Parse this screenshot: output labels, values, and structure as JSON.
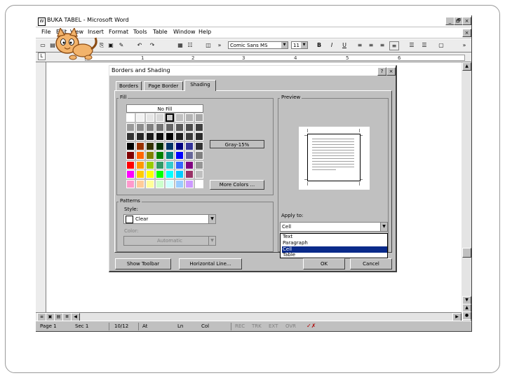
{
  "window": {
    "title": "BUKA TABEL - Microsoft Word",
    "controls": [
      "_",
      "🗗",
      "×"
    ],
    "doc_close": "×"
  },
  "menu": [
    "File",
    "Edit",
    "View",
    "Insert",
    "Format",
    "Tools",
    "Table",
    "Window",
    "Help"
  ],
  "toolbar": {
    "font_name": "Comic Sans MS",
    "font_size": "11",
    "bold": "B",
    "italic": "I",
    "underline": "U"
  },
  "ruler_numbers": [
    "1",
    "2",
    "3",
    "4",
    "5",
    "6"
  ],
  "statusbar": {
    "page": "Page 1",
    "section": "Sec 1",
    "pages": "10/12",
    "at": "At",
    "ln": "Ln",
    "col": "Col",
    "rec": "REC",
    "trk": "TRK",
    "ext": "EXT",
    "ovr": "OVR"
  },
  "dialog": {
    "title": "Borders and Shading",
    "help": "?",
    "close": "×",
    "tabs": [
      "Borders",
      "Page Border",
      "Shading"
    ],
    "active_tab": "Shading",
    "fill_label": "Fill",
    "no_fill": "No Fill",
    "selected_fill": "Gray-15%",
    "more_colors": "More Colors ...",
    "patterns_label": "Patterns",
    "style_label": "Style:",
    "style_value": "Clear",
    "color_label": "Color:",
    "color_value": "Automatic",
    "preview_label": "Preview",
    "apply_to_label": "Apply to:",
    "apply_to_value": "Cell",
    "apply_options": [
      "Text",
      "Paragraph",
      "Cell",
      "Table"
    ],
    "apply_selected": "Cell",
    "toolbar_button": "Show Toolbar",
    "horizontal_line": "Horizontal Line...",
    "ok": "OK",
    "cancel": "Cancel"
  },
  "palette": [
    [
      "#ffffff",
      "#f2f2f2",
      "#e6e6e6",
      "#d9d9d9",
      "#cccccc",
      "#c0c0c0",
      "#b3b3b3",
      "#a6a6a6"
    ],
    [
      "#999999",
      "#8c8c8c",
      "#808080",
      "#737373",
      "#666666",
      "#595959",
      "#4d4d4d",
      "#404040"
    ],
    [
      "#333333",
      "#262626",
      "#1a1a1a",
      "#0d0d0d",
      "#000000",
      "#1f1f1f",
      "#3a3a3a",
      "#2b2b2b"
    ],
    [
      "#000000",
      "#993300",
      "#333300",
      "#003300",
      "#003366",
      "#000080",
      "#333399",
      "#333333"
    ],
    [
      "#800000",
      "#ff6600",
      "#808000",
      "#008000",
      "#008080",
      "#0000ff",
      "#666699",
      "#808080"
    ],
    [
      "#ff0000",
      "#ff9900",
      "#99cc00",
      "#339966",
      "#33cccc",
      "#3366ff",
      "#800080",
      "#969696"
    ],
    [
      "#ff00ff",
      "#ffcc00",
      "#ffff00",
      "#00ff00",
      "#00ffff",
      "#00ccff",
      "#993366",
      "#c0c0c0"
    ],
    [
      "#ff99cc",
      "#ffcc99",
      "#ffff99",
      "#ccffcc",
      "#ccffff",
      "#99ccff",
      "#cc99ff",
      "#ffffff"
    ]
  ],
  "palette_selected": [
    0,
    4
  ]
}
